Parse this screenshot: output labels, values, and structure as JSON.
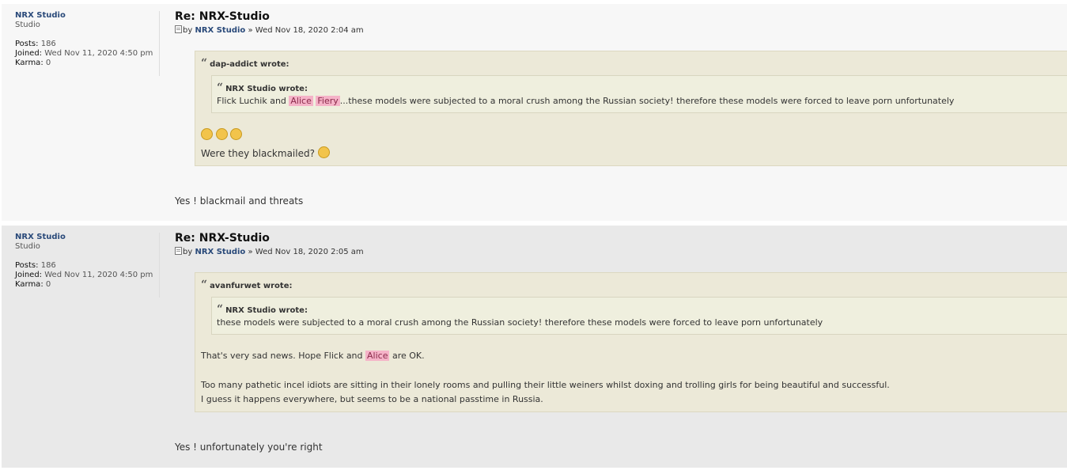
{
  "posts": [
    {
      "author": {
        "name": "NRX Studio",
        "rank": "Studio",
        "posts_label": "Posts:",
        "posts": "186",
        "joined_label": "Joined:",
        "joined": "Wed Nov 11, 2020 4:50 pm",
        "karma_label": "Karma:",
        "karma": "0"
      },
      "title": "Re: NRX-Studio",
      "by": "by",
      "post_author": "NRX Studio",
      "sep": "»",
      "date": "Wed Nov 18, 2020 2:04 am",
      "quote_outer_cite": "dap-addict wrote:",
      "quote_inner_cite": "NRX Studio wrote:",
      "quote_inner_text_pre": "Flick Luchik and ",
      "hl1": "Alice",
      "hl2": "Fiery",
      "quote_inner_text_post": "...these models were subjected to a moral crush among the Russian society! therefore these models were forced to leave porn unfortunately",
      "quote_outer_text": "Were they blackmailed?",
      "reply": "Yes ! blackmail and threats"
    },
    {
      "author": {
        "name": "NRX Studio",
        "rank": "Studio",
        "posts_label": "Posts:",
        "posts": "186",
        "joined_label": "Joined:",
        "joined": "Wed Nov 11, 2020 4:50 pm",
        "karma_label": "Karma:",
        "karma": "0"
      },
      "title": "Re: NRX-Studio",
      "by": "by",
      "post_author": "NRX Studio",
      "sep": "»",
      "date": "Wed Nov 18, 2020 2:05 am",
      "quote_outer_cite": "avanfurwet wrote:",
      "quote_inner_cite": "NRX Studio wrote:",
      "quote_inner_text": "these models were subjected to a moral crush among the Russian society! therefore these models were forced to leave porn unfortunately",
      "line1_pre": "That's very sad news. Hope Flick and ",
      "hl1": "Alice",
      "line1_post": " are OK.",
      "line2": "Too many pathetic incel idiots are sitting in their lonely rooms and pulling their little weiners whilst doxing and trolling girls for being beautiful and successful.",
      "line3": "I guess it happens everywhere, but seems to be a national passtime in Russia.",
      "reply": "Yes ! unfortunately you're right"
    }
  ]
}
